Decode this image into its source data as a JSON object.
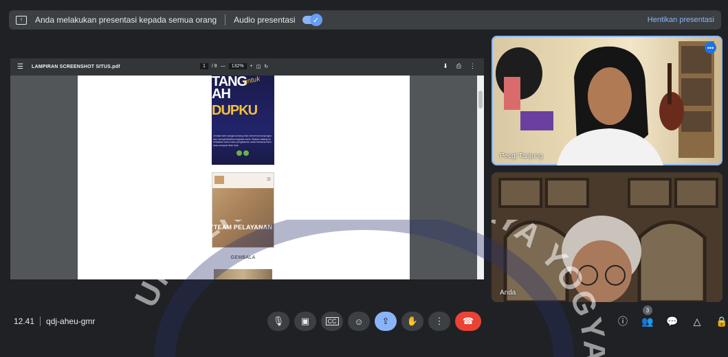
{
  "banner": {
    "message": "Anda melakukan presentasi kepada semua orang",
    "audio_label": "Audio presentasi",
    "stop_label": "Hentikan presentasi",
    "icons": {
      "present": "present-to-all-icon",
      "toggle": "check-icon"
    }
  },
  "viewer": {
    "file_name": "LAMPIRAN SCREENSHOT SITUS.pdf",
    "page_current": "1",
    "page_total": "/ 8",
    "zoom": "132%",
    "menu_icon": "☰",
    "zoom_out": "—",
    "zoom_in": "+",
    "fit_icon": "◫",
    "rotate_icon": "↻",
    "download_icon": "⬇",
    "print_icon": "⎙",
    "more_icon": "⋮"
  },
  "document": {
    "poster1_lines": [
      "TANG",
      "AH",
      "DUPKU"
    ],
    "poster1_script": "untuk",
    "poster1_body": "Jemaat kami sangat senang bisa menerima kunjungan dan memperlihatkan kegiatan kami. Silakan datang ke kebaktian kami maka pengalaman anda bersama kami akan menjadi lebih baik.",
    "poster2_label": "TEAM PELAYANAN",
    "section_label": "GEMBALA"
  },
  "participants": [
    {
      "name": "Pecgi Tanjung"
    },
    {
      "name": "Anda"
    }
  ],
  "meeting": {
    "time": "12.41",
    "code": "qdj-aheu-gmr"
  },
  "controls": {
    "mic": "🎙",
    "camera": "▣",
    "captions": "CC",
    "emoji": "☺",
    "present": "⇪",
    "raise_hand": "✋",
    "more": "⋮",
    "end_call": "☎"
  },
  "right_controls": {
    "info": "ⓘ",
    "people": "👥",
    "people_count": "3",
    "chat": "💬",
    "activities": "△",
    "host": "🔒"
  },
  "watermark": {
    "text": "UNIVERSITAS ATMA JAYA YOGYAKARTA"
  },
  "colors": {
    "background": "#202124",
    "accent": "#8ab4f8",
    "end_call": "#ea4335",
    "panel": "#3c4043"
  }
}
